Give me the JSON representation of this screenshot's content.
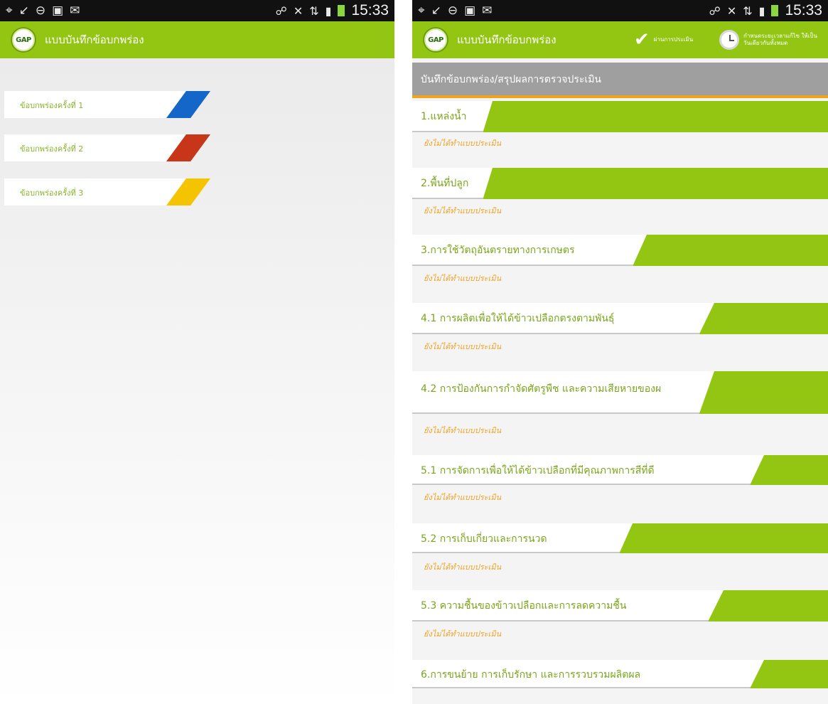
{
  "status_bar": {
    "time": "15:33"
  },
  "app": {
    "logo_text": "GAP",
    "title": "แบบบันทึกข้อบกพร่อง"
  },
  "left_screen": {
    "defects": [
      {
        "label": "ข้อบกพร่องครั้งที่ 1",
        "color": "#1466c8"
      },
      {
        "label": "ข้อบกพร่องครั้งที่ 2",
        "color": "#c8361a"
      },
      {
        "label": "ข้อบกพร่องครั้งที่ 3",
        "color": "#f5c400"
      }
    ]
  },
  "right_screen": {
    "actions": {
      "pass_label": "ผ่านการประเมิน",
      "schedule_label": "กำหนดระยะเวลาแก้ไข ให้เป็นวันเดียวกันทั้งหมด"
    },
    "section_header": "บันทึกข้อบกพร่อง/สรุปผลการตรวจประเมิน",
    "categories": [
      {
        "label": "1.แหล่งน้ำ",
        "status": "ยังไม่ได้ทำแบบประเมิน"
      },
      {
        "label": "2.พื้นที่ปลูก",
        "status": "ยังไม่ได้ทำแบบประเมิน"
      },
      {
        "label": "3.การใช้วัตถุอันตรายทางการเกษตร",
        "status": "ยังไม่ได้ทำแบบประเมิน"
      },
      {
        "label": "4.1 การผลิตเพื่อให้ได้ข้าวเปลือกตรงตามพันธุ์",
        "status": "ยังไม่ได้ทำแบบประเมิน"
      },
      {
        "label": "4.2 การป้องกันการกำจัดศัตรูพืช และความเสียหายของผ",
        "status": "ยังไม่ได้ทำแบบประเมิน"
      },
      {
        "label": "5.1 การจัดการเพื่อให้ได้ข้าวเปลือกที่มีคุณภาพการสีที่ดี",
        "status": "ยังไม่ได้ทำแบบประเมิน"
      },
      {
        "label": "5.2 การเก็บเกี่ยวและการนวด",
        "status": "ยังไม่ได้ทำแบบประเมิน"
      },
      {
        "label": "5.3 ความชื้นของข้าวเปลือกและการลดความชื้น",
        "status": "ยังไม่ได้ทำแบบประเมิน"
      },
      {
        "label": "6.การขนย้าย การเก็บรักษา และการรวบรวมผลิตผล",
        "status": ""
      }
    ]
  }
}
